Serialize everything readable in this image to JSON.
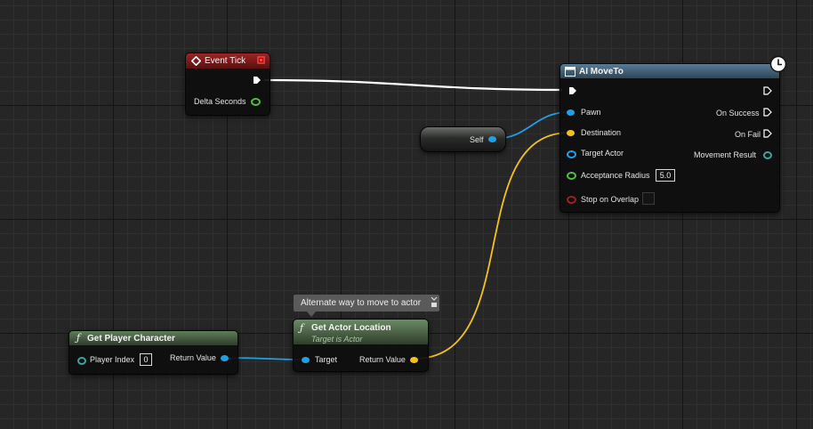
{
  "event_tick": {
    "title": "Event Tick",
    "pins": {
      "delta_seconds": "Delta Seconds"
    }
  },
  "ai_move_to": {
    "title": "AI MoveTo",
    "inputs": {
      "pawn": "Pawn",
      "destination": "Destination",
      "target_actor": "Target Actor",
      "acceptance_radius": "Acceptance Radius",
      "acceptance_radius_value": "5.0",
      "stop_on_overlap": "Stop on Overlap"
    },
    "outputs": {
      "on_success": "On Success",
      "on_fail": "On Fail",
      "movement_result": "Movement Result"
    }
  },
  "self_node": {
    "label": "Self"
  },
  "comment_bubble": {
    "text": "Alternate way to move to actor"
  },
  "get_player_character": {
    "title": "Get Player Character",
    "pins": {
      "player_index": "Player Index",
      "player_index_value": "0",
      "return_value": "Return Value"
    }
  },
  "get_actor_location": {
    "title": "Get Actor Location",
    "subtitle": "Target is Actor",
    "pins": {
      "target": "Target",
      "return_value": "Return Value"
    }
  },
  "colors": {
    "exec_wire": "#ffffff",
    "object_wire": "#1ea0e8",
    "vector_wire": "#f3c21a",
    "event_header": "#8a1c1c",
    "function_header": "#4c6b47",
    "latent_header": "#3d5a70"
  }
}
